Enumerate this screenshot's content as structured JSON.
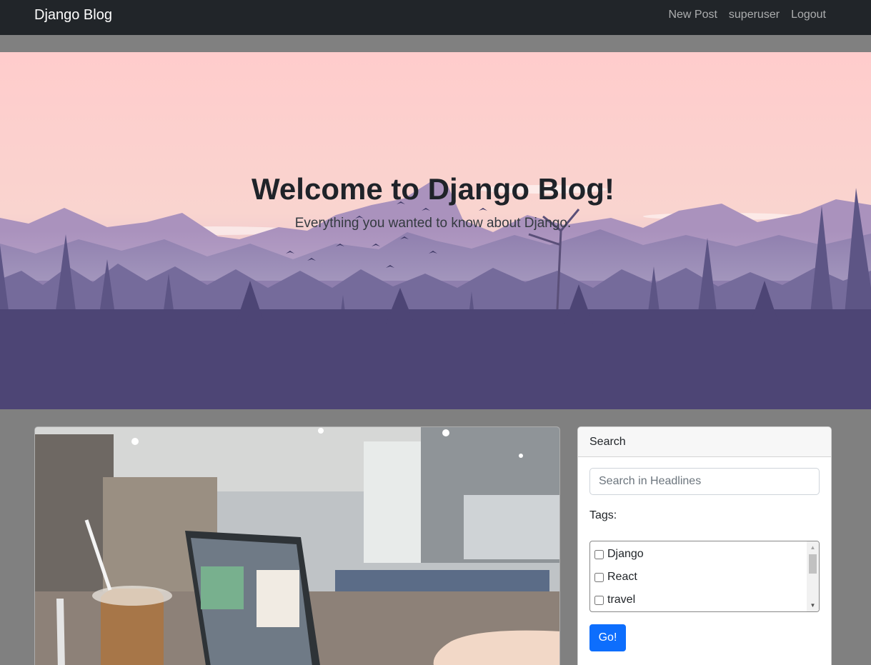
{
  "navbar": {
    "brand": "Django Blog",
    "links": [
      "New Post",
      "superuser",
      "Logout"
    ]
  },
  "hero": {
    "title": "Welcome to Django Blog!",
    "subtitle": "Everything you wanted to know about Django."
  },
  "sidebar": {
    "card_header": "Search",
    "search_placeholder": "Search in Headlines",
    "tags_label": "Tags:",
    "tags": [
      "Django",
      "React",
      "travel"
    ],
    "go_label": "Go!"
  },
  "colors": {
    "navbar_bg": "#212529",
    "page_bg": "#808080",
    "primary_button": "#0d6efd"
  }
}
